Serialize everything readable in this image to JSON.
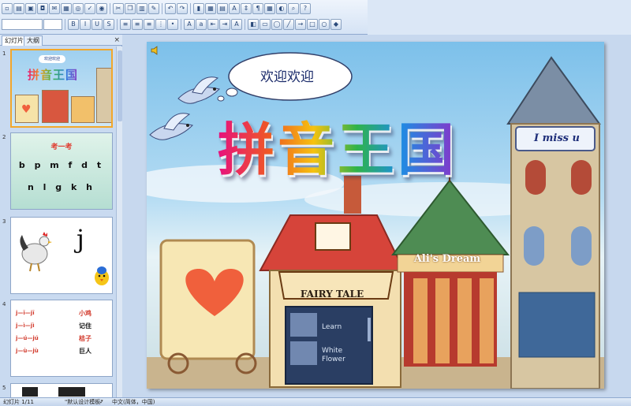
{
  "tabs": {
    "slides": "幻灯片",
    "outline": "大纲",
    "close": "×"
  },
  "thumbnails": {
    "numbers": [
      "1",
      "2",
      "3",
      "4",
      "5"
    ],
    "t1": {
      "bubble": "欢迎欢迎",
      "title": "拼音王国"
    },
    "t2": {
      "title": "考一考",
      "row1": "b p m f d t",
      "row2": "n l g k h"
    },
    "t3": {
      "letter": "j"
    },
    "t4": {
      "rows": [
        "j—ī—jī",
        "j—ì—jì",
        "j—ú—jú",
        "j—ù—jù"
      ],
      "words": [
        "小鸡",
        "记住",
        "桔子",
        "巨人"
      ]
    }
  },
  "slide": {
    "bubble_text": "欢迎欢迎",
    "title": "拼音王国",
    "tower_sign": "I miss u",
    "fairy_sign": "FAIRY TALE",
    "carousel_sign": "Ali's Dream",
    "menu": [
      "Learn",
      "White Flower"
    ]
  },
  "status": {
    "slide": "幻灯片 1/11",
    "theme": "\"默认设计模板\"",
    "lang": "中文(简体，中国)"
  },
  "colors": {
    "heart": "#f0603c",
    "sky": "#7cc0ea",
    "selected_border": "#f2a72b"
  }
}
